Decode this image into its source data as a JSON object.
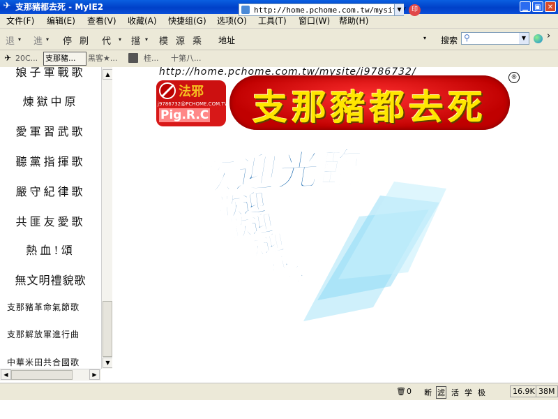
{
  "window": {
    "title": "支那豬都去死 - MyIE2",
    "icon": "myie-icon",
    "controls": [
      "minimize",
      "maximize",
      "close"
    ]
  },
  "menu": [
    "文件(F)",
    "编辑(E)",
    "查看(V)",
    "收藏(A)",
    "快捷组(G)",
    "选项(O)",
    "工具(T)",
    "窗口(W)",
    "帮助(H)"
  ],
  "toolbar": {
    "back": "退",
    "forward": "進",
    "stop": "停",
    "refresh": "刷",
    "proxy": "代",
    "block": "擋",
    "mode": "模",
    "source": "源",
    "more": "乘",
    "address_label": "地址",
    "address_value": "http://home.pchome.com.tw/mysite/",
    "search_label": "搜索",
    "search_value": ""
  },
  "tabs": [
    {
      "label": "20C...",
      "active": false
    },
    {
      "label": "支那豬...",
      "active": true
    },
    {
      "label": "黑客★...",
      "active": false
    },
    {
      "label": "桂...",
      "active": false
    },
    {
      "label": "十第八...",
      "active": false
    }
  ],
  "sidebar": {
    "items": [
      {
        "label": "娘子軍戰歌",
        "size": "big"
      },
      {
        "label": "煉獄中原",
        "size": "big"
      },
      {
        "label": "愛軍習武歌",
        "size": "big"
      },
      {
        "label": "聽黨指揮歌",
        "size": "big"
      },
      {
        "label": "嚴守紀律歌",
        "size": "big"
      },
      {
        "label": "共匪友愛歌",
        "size": "big"
      },
      {
        "label": "熱血!頌",
        "size": "big"
      },
      {
        "label": "無文明禮貌歌",
        "size": "big"
      },
      {
        "label": "支那豬革命氣節歌",
        "size": "small"
      },
      {
        "label": "支那解放軍進行曲",
        "size": "small"
      },
      {
        "label": "中華米田共合國歌",
        "size": "small"
      }
    ]
  },
  "main": {
    "url_text": "http://home.pchome.com.tw/mysite/j9786732/",
    "logo": {
      "script": "法邪",
      "email": "j9786732@PCHOME.COM.TW",
      "name": "Pig.R.C"
    },
    "banner_title": "支那豬都去死",
    "registered_mark": "®",
    "welcome_text": "歡迎光臨",
    "welcome_echo": "歡迎",
    "colors": {
      "banner_red": "#d00000",
      "banner_yellow": "#ffe600",
      "welcome_blue": "#1a6ab0",
      "echo_cyan": "#5cc8f0"
    }
  },
  "status": {
    "trash_count": "0",
    "mode_chars": [
      "断",
      "滤",
      "活",
      "学",
      "极"
    ],
    "speed": "16.9K",
    "memory": "38M"
  }
}
